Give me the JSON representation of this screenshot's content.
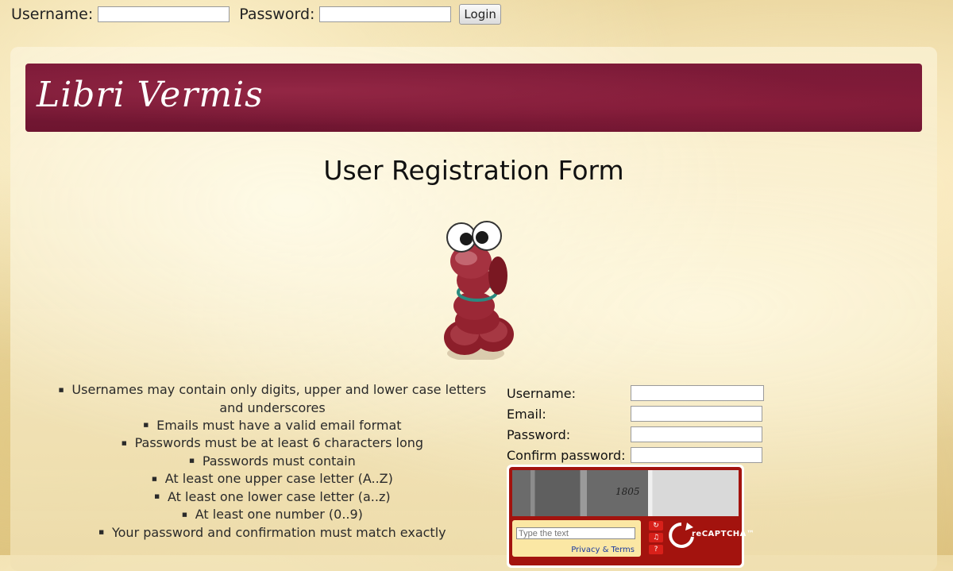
{
  "login": {
    "username_label": "Username:",
    "password_label": "Password:",
    "username_value": "",
    "password_value": "",
    "login_button": "Login"
  },
  "site": {
    "brand": "Libri Vermis"
  },
  "page": {
    "title": "User Registration Form"
  },
  "rules": [
    "Usernames may contain only digits, upper and lower case letters and underscores",
    "Emails must have a valid email format",
    "Passwords must be at least 6 characters long",
    "Passwords must contain",
    "At least one upper case letter (A..Z)",
    "At least one lower case letter (a..z)",
    "At least one number (0..9)",
    "Your password and confirmation must match exactly"
  ],
  "form": {
    "username_label": "Username:",
    "email_label": "Email:",
    "password_label": "Password:",
    "confirm_label": "Confirm password:",
    "username_value": "",
    "email_value": "",
    "password_value": "",
    "confirm_value": ""
  },
  "captcha": {
    "image_number": "1805",
    "input_placeholder": "Type the text",
    "privacy_link": "Privacy & Terms",
    "logo_text": "reCAPTCHA™",
    "icons": [
      "refresh-icon",
      "audio-icon",
      "help-icon"
    ]
  },
  "colors": {
    "banner": "#7d1a38",
    "captcha_red": "#a3130e",
    "captcha_yellow": "#fbe7a4"
  }
}
